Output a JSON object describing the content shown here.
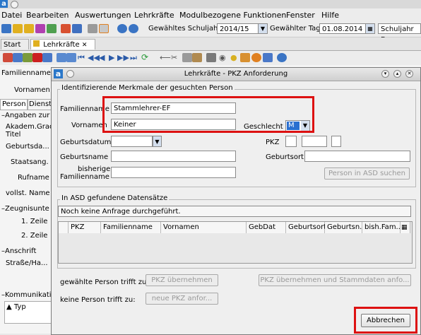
{
  "app": {
    "logo_letter": "a"
  },
  "menu": [
    "Datei",
    "Bearbeiten",
    "Auswertungen",
    "Lehrkräfte",
    "Modulbezogene Funktionen",
    "Fenster",
    "Hilfe"
  ],
  "toolbar": {
    "schuljahr_label": "Gewähltes Schuljahr",
    "schuljahr_value": "2014/15",
    "tag_label": "Gewählter Tag",
    "tag_value": "01.08.2014",
    "schuljahr_be_value": "Schuljahr Be"
  },
  "tabs": [
    {
      "label": "Start",
      "close": "✕"
    },
    {
      "label": "Lehrkräfte",
      "close": "✕"
    }
  ],
  "background_form": {
    "familienname": "Familienname",
    "vornamen": "Vornamen",
    "subtab_person": "Person",
    "subtab_dienst": "Dienst",
    "angaben": "Angaben zur",
    "akadem": "Akadem.Grad",
    "titel": "Titel",
    "geburtsdatum": "Geburtsda...",
    "staatsang": "Staatsang.",
    "rufname": "Rufname",
    "vollst_name": "vollst. Name",
    "zeugnis": "Zeugnisunte",
    "zeile1": "1. Zeile",
    "zeile2": "2. Zeile",
    "anschrift": "Anschrift",
    "strasse": "Straße/Ha...",
    "kommunikation": "Kommunikati",
    "typ": "Typ"
  },
  "dialog": {
    "title": "Lehrkräfte - PKZ Anforderung",
    "group1_title": "Identifizierende Merkmale der gesuchten Person",
    "familienname_label": "Familienname",
    "familienname_value": "Stammlehrer-EF",
    "vornamen_label": "Vornamen",
    "vornamen_value": "Keiner",
    "geschlecht_label": "Geschlecht",
    "geschlecht_value": "M",
    "geburtsdatum_label": "Geburtsdatum",
    "pkz_label": "PKZ",
    "geburtsname_label": "Geburtsname",
    "geburtsort_label": "Geburtsort",
    "bisheriger_label_1": "bisheriger",
    "bisheriger_label_2": "Familienname",
    "search_button": "Person in ASD suchen",
    "group2_title": "In ASD gefundene Datensätze",
    "status_text": "Noch keine Anfrage durchgeführt.",
    "columns": [
      "PKZ",
      "Familienname",
      "Vornamen",
      "GebDat",
      "Geburtsort",
      "Geburtsn...",
      "bish.Fam..."
    ],
    "trifft_zu_label": "gewählte Person trifft zu:",
    "pkz_uebernehmen": "PKZ übernehmen",
    "pkz_stamm_uebernehmen": "PKZ übernehmen und Stammdaten anfo...",
    "trifft_nicht_label": "keine Person trifft zu:",
    "neue_pkz": "neue PKZ anfor...",
    "abbrechen": "Abbrechen"
  },
  "colors": {
    "highlight": "#dd1111",
    "accent": "#2a77c9"
  }
}
